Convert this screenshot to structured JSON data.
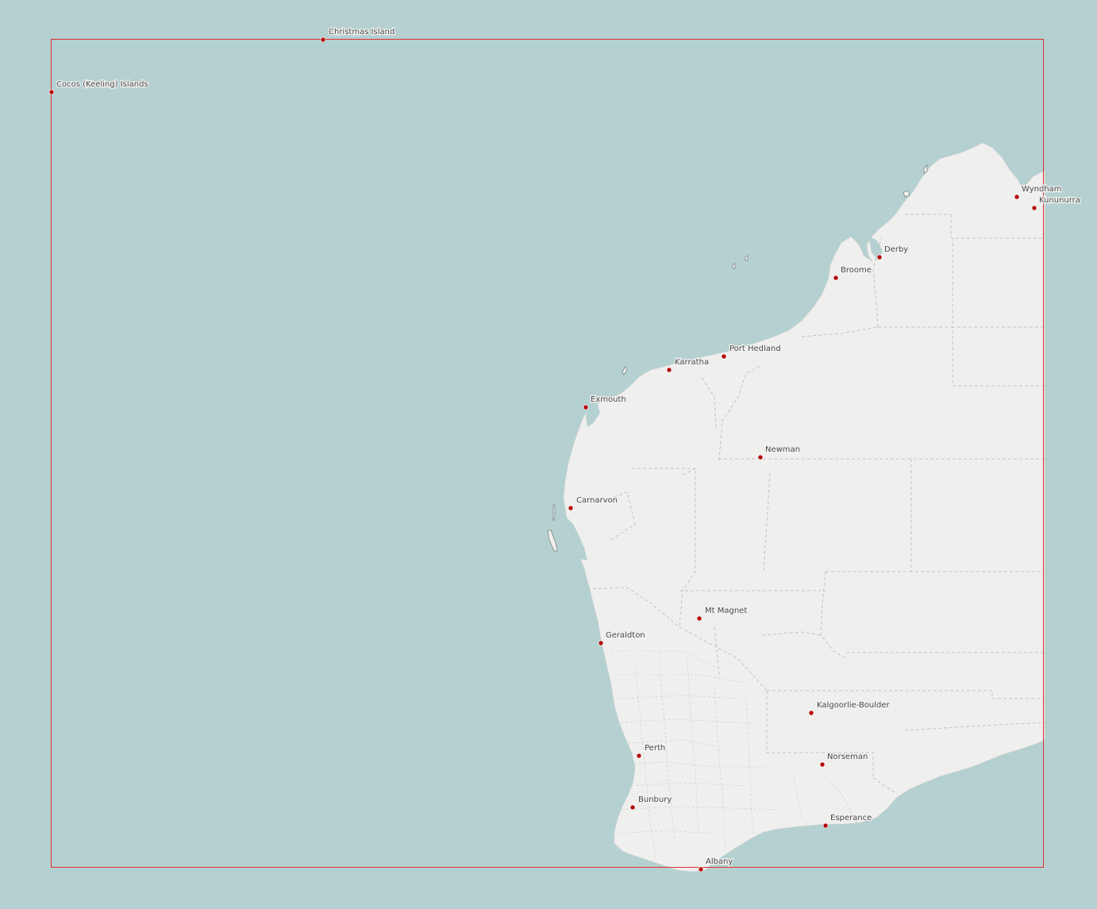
{
  "map": {
    "colors": {
      "water": "#b5d0d0",
      "land": "#efefee",
      "frame": "#e03030",
      "city_dot": "#b30000",
      "label": "#4a4a4a",
      "boundary": "#b8b8b8"
    },
    "cities": [
      {
        "id": "christmas-island",
        "name": "Christmas Island"
      },
      {
        "id": "cocos-keeling-islands",
        "name": "Cocos (Keeling) Islands"
      },
      {
        "id": "wyndham",
        "name": "Wyndham"
      },
      {
        "id": "kununurra",
        "name": "Kununurra"
      },
      {
        "id": "derby",
        "name": "Derby"
      },
      {
        "id": "broome",
        "name": "Broome"
      },
      {
        "id": "port-hedland",
        "name": "Port Hedland"
      },
      {
        "id": "karratha",
        "name": "Karratha"
      },
      {
        "id": "exmouth",
        "name": "Exmouth"
      },
      {
        "id": "newman",
        "name": "Newman"
      },
      {
        "id": "carnarvon",
        "name": "Carnarvon"
      },
      {
        "id": "mt-magnet",
        "name": "Mt Magnet"
      },
      {
        "id": "geraldton",
        "name": "Geraldton"
      },
      {
        "id": "kalgoorlie-boulder",
        "name": "Kalgoorlie-Boulder"
      },
      {
        "id": "perth",
        "name": "Perth"
      },
      {
        "id": "norseman",
        "name": "Norseman"
      },
      {
        "id": "bunbury",
        "name": "Bunbury"
      },
      {
        "id": "esperance",
        "name": "Esperance"
      },
      {
        "id": "albany",
        "name": "Albany"
      }
    ]
  }
}
